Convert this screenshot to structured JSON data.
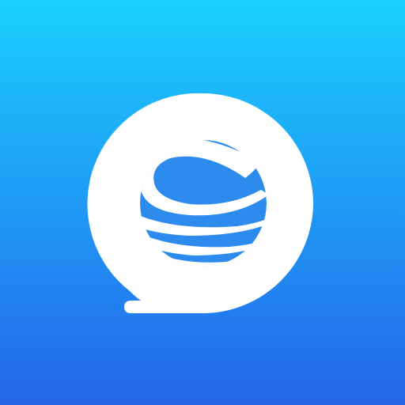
{
  "app_icon": {
    "icon_name": "chat-bubble-globe-icon",
    "colors": {
      "gradient_top": "#1ad0ff",
      "gradient_bottom": "#2565ea",
      "bubble": "#ffffff",
      "globe": "#2e8bee"
    }
  }
}
